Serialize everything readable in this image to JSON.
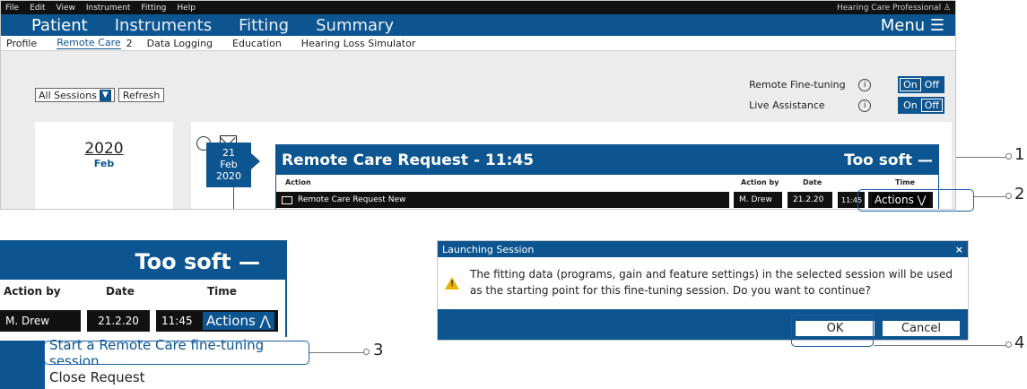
{
  "menubar": {
    "items": [
      "File",
      "Edit",
      "View",
      "Instrument",
      "Fitting",
      "Help"
    ],
    "user_label": "Hearing Care Professional ♙"
  },
  "navbar": {
    "items": [
      "Patient",
      "Instruments",
      "Fitting",
      "Summary"
    ],
    "menu_label": "Menu ☰"
  },
  "tabs": {
    "profile": "Profile",
    "remote_care": "Remote Care",
    "remote_care_badge": "2",
    "data_logging": "Data Logging",
    "education": "Education",
    "simulator": "Hearing Loss Simulator"
  },
  "controls": {
    "sessions_select": "All Sessions",
    "refresh": "Refresh",
    "remote_finetuning_label": "Remote Fine-tuning",
    "live_assistance_label": "Live Assistance",
    "on_label": "On",
    "off_label": "Off",
    "info_glyph": "i"
  },
  "timeline": {
    "year": "2020",
    "month": "Feb",
    "date_day": "21",
    "date_month": "Feb",
    "date_year": "2020"
  },
  "request": {
    "title": "Remote Care Request - 11:45",
    "status": "Too soft —",
    "col_action": "Action",
    "col_action_by": "Action by",
    "col_date": "Date",
    "col_time": "Time",
    "row_action": "Remote Care Request New",
    "row_action_by": "M. Drew",
    "row_date": "21.2.20",
    "row_time": "11:45",
    "actions_label": "Actions ⋁"
  },
  "zoom": {
    "status": "Too soft —",
    "col_action_by": "Action by",
    "col_date": "Date",
    "col_time": "Time",
    "row_action_by": "M. Drew",
    "row_date": "21.2.20",
    "row_time": "11:45",
    "actions_label": "Actions ⋀",
    "menu_items": [
      "Start a Remote Care fine-tuning session",
      "Close Request"
    ]
  },
  "dialog": {
    "title": "Launching Session",
    "close": "×",
    "message": "The fitting data (programs, gain and feature settings) in the selected session will be used as the starting point for this fine-tuning session.  Do you want to continue?",
    "warn_glyph": "!",
    "ok": "OK",
    "cancel": "Cancel"
  },
  "callouts": [
    "1",
    "2",
    "3",
    "4"
  ],
  "colors": {
    "brand_blue": "#0d5590",
    "menubar_black": "#111111",
    "warning_yellow": "#e9b400",
    "highlight": "#1c5fa8"
  }
}
